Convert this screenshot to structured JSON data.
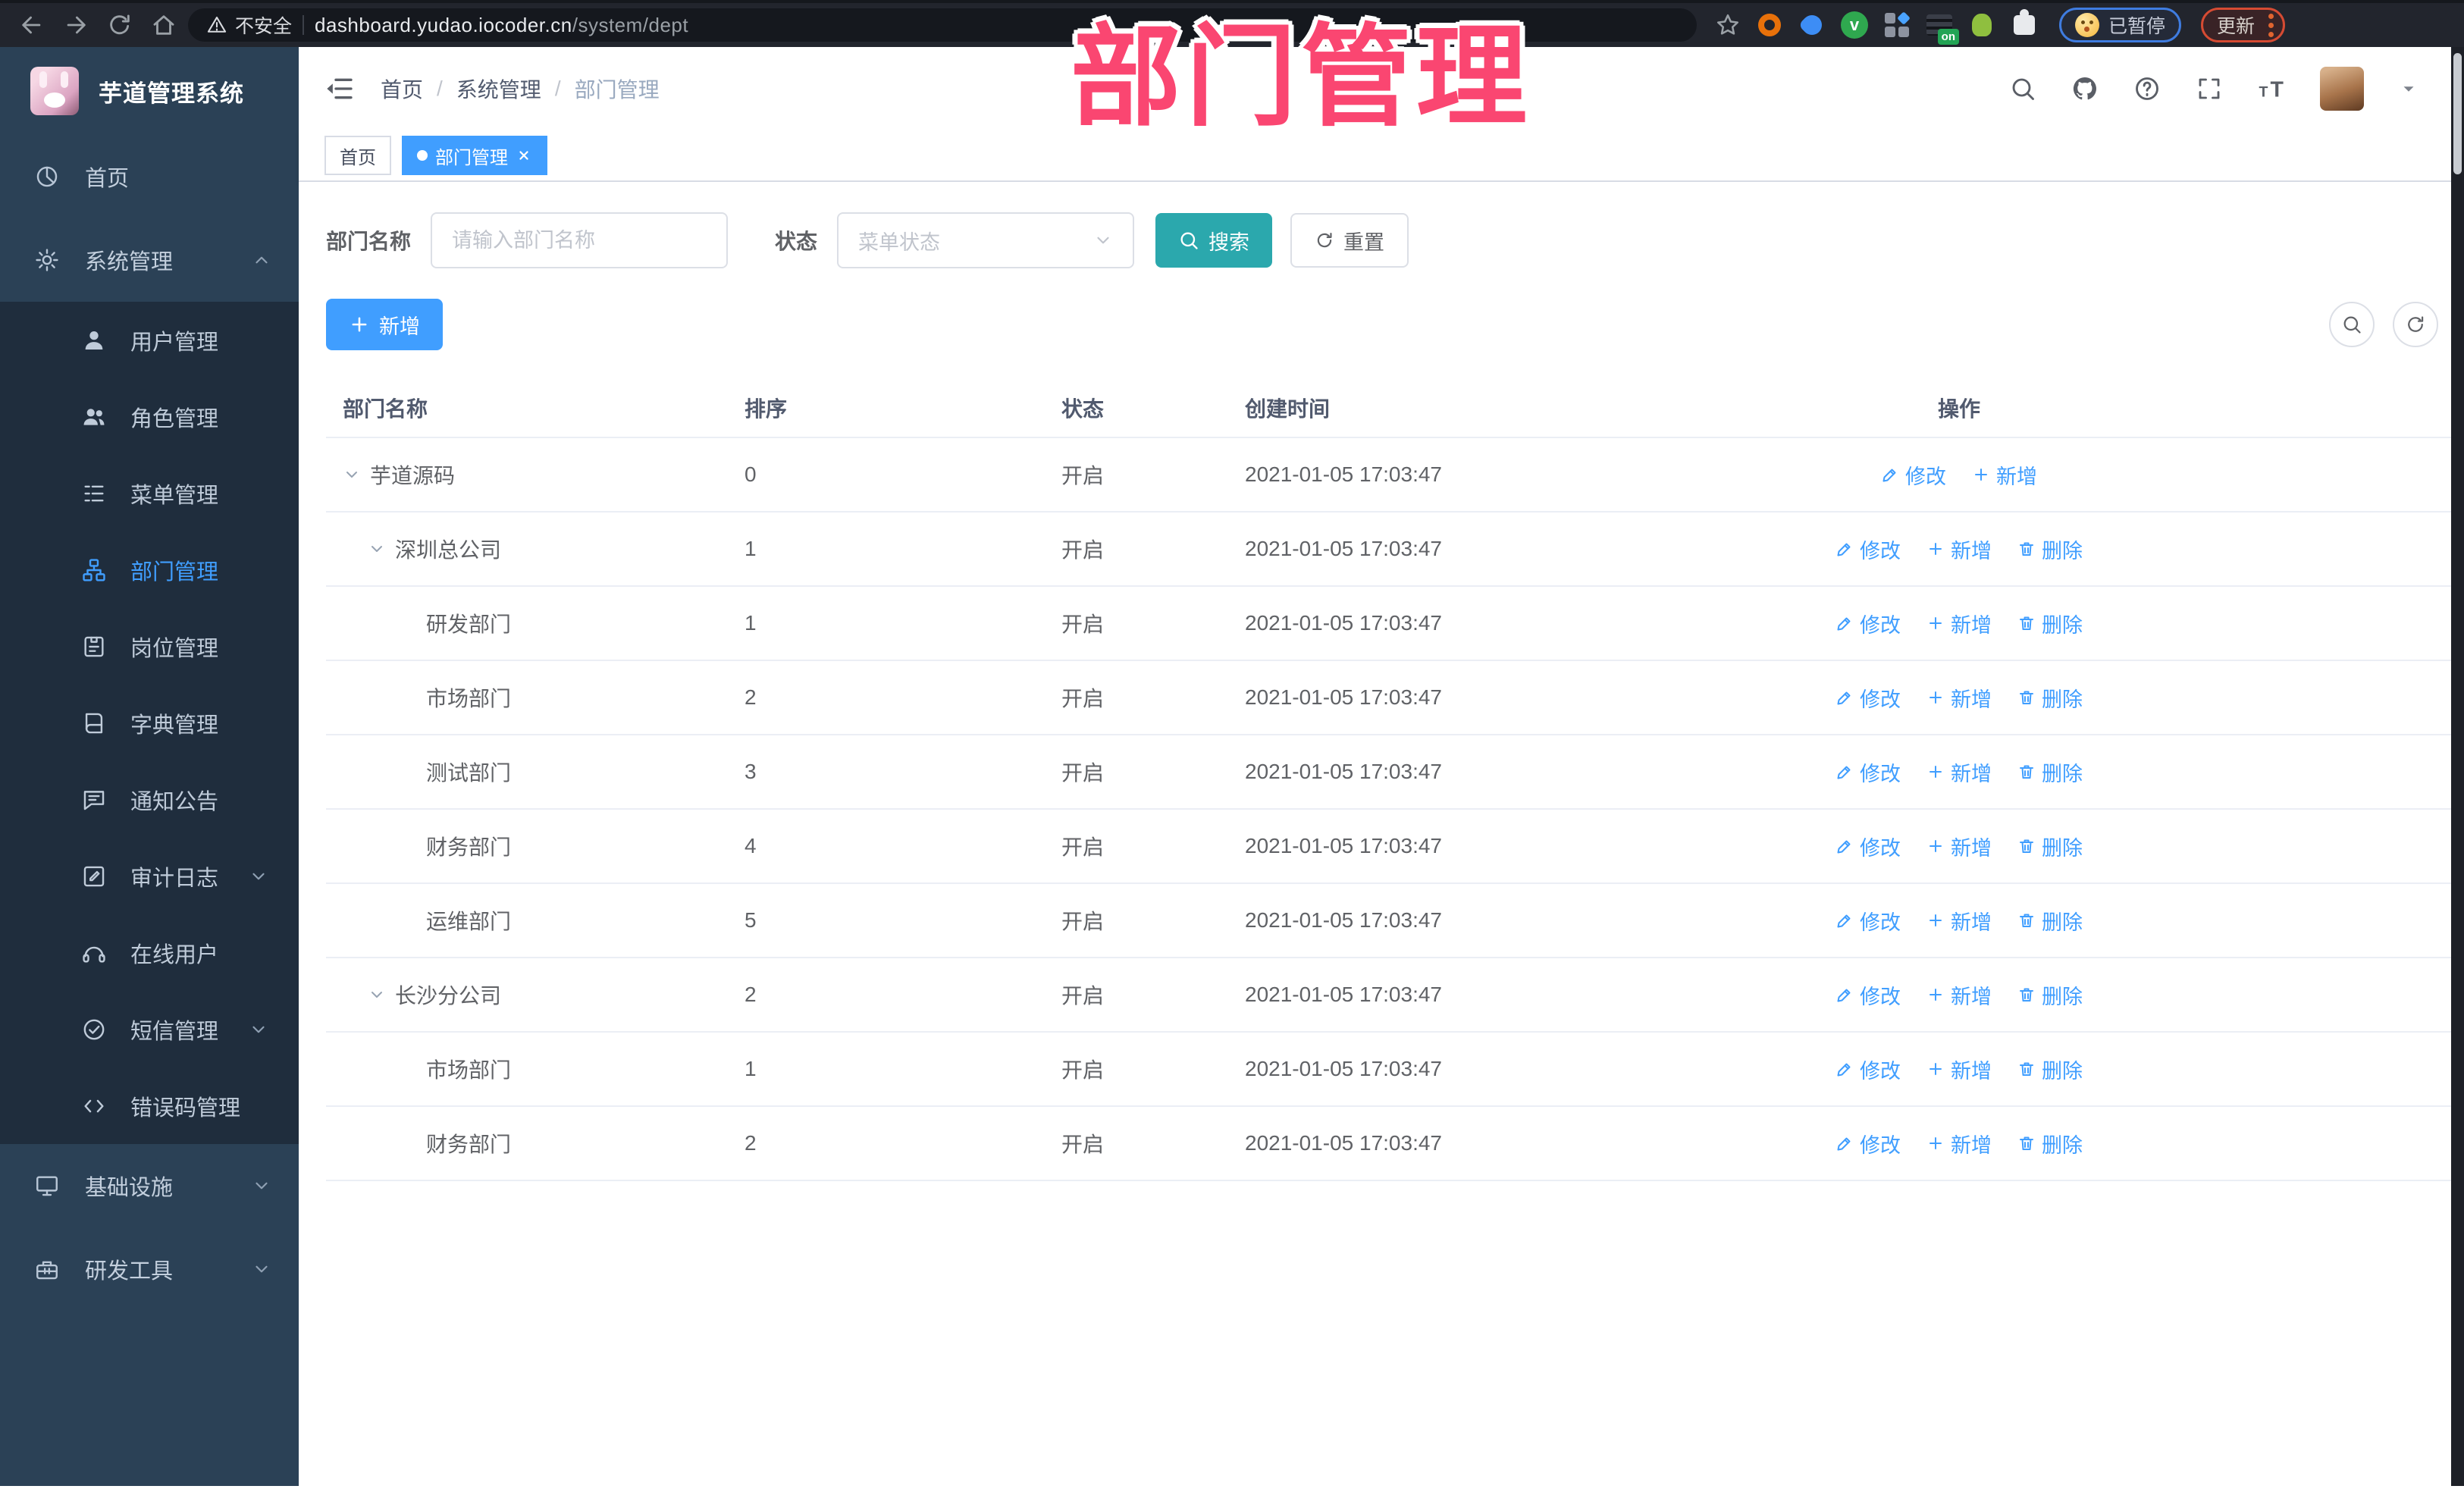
{
  "theme": {
    "accent": "#409EFF",
    "search_button": "#2BA8AD",
    "overlay_pink": "#FA4671",
    "sidebar_bg": "#2B4156",
    "submenu_bg": "#1F2D3D"
  },
  "browser": {
    "nav_icons": [
      "back-icon",
      "forward-icon",
      "reload-icon",
      "home-icon"
    ],
    "security_text": "不安全",
    "url_host": "dashboard.yudao.iocoder.cn",
    "url_path": "/system/dept",
    "extensions": [
      {
        "icon": "bookmark-star-icon"
      },
      {
        "icon": "adblock-ring-icon"
      },
      {
        "icon": "blue-drop-icon"
      },
      {
        "icon": "green-check-icon",
        "glyph": "v"
      },
      {
        "icon": "tab-grid-icon"
      },
      {
        "icon": "onetab-icon",
        "badge": "on"
      },
      {
        "icon": "android-figure-icon"
      },
      {
        "icon": "puzzle-icon"
      }
    ],
    "paused_pill": {
      "icon": "dizzy-face-icon",
      "label": "已暂停"
    },
    "update_pill": {
      "label": "更新",
      "menu_icon": "kebab-icon"
    }
  },
  "sidebar": {
    "app_title": "芋道管理系统",
    "logo_icon": "bunny-logo",
    "top_menu": [
      {
        "icon": "dashboard-icon",
        "label": "首页"
      },
      {
        "icon": "gear-icon",
        "label": "系统管理",
        "chevron": "up"
      }
    ],
    "submenu": [
      {
        "icon": "user-icon",
        "label": "用户管理"
      },
      {
        "icon": "users-icon",
        "label": "角色管理"
      },
      {
        "icon": "menu-list-icon",
        "label": "菜单管理"
      },
      {
        "icon": "org-tree-icon",
        "label": "部门管理",
        "active": true
      },
      {
        "icon": "badge-icon",
        "label": "岗位管理"
      },
      {
        "icon": "book-icon",
        "label": "字典管理"
      },
      {
        "icon": "chat-bubble-icon",
        "label": "通知公告"
      },
      {
        "icon": "log-edit-icon",
        "label": "审计日志",
        "chevron": "down"
      },
      {
        "icon": "headset-icon",
        "label": "在线用户"
      },
      {
        "icon": "check-circle-icon",
        "label": "短信管理",
        "chevron": "down"
      },
      {
        "icon": "code-icon",
        "label": "错误码管理"
      }
    ],
    "bottom_menu": [
      {
        "icon": "monitor-icon",
        "label": "基础设施",
        "chevron": "down"
      },
      {
        "icon": "toolbox-icon",
        "label": "研发工具",
        "chevron": "down"
      }
    ]
  },
  "header": {
    "breadcrumb": [
      "首页",
      "系统管理",
      "部门管理"
    ],
    "right_icons": [
      "search-icon",
      "github-icon",
      "question-icon",
      "fullscreen-icon",
      "font-size-icon"
    ]
  },
  "tags": [
    {
      "label": "首页",
      "active": false
    },
    {
      "label": "部门管理",
      "active": true,
      "closable": true
    }
  ],
  "overlay_title": "部门管理",
  "filters": {
    "name_label": "部门名称",
    "name_placeholder": "请输入部门名称",
    "status_label": "状态",
    "status_placeholder": "菜单状态",
    "search_label": "搜索",
    "reset_label": "重置"
  },
  "toolbar": {
    "add_label": "新增"
  },
  "table": {
    "headers": [
      "部门名称",
      "排序",
      "状态",
      "创建时间",
      "操作"
    ],
    "rows": [
      {
        "name": "芋道源码",
        "level": 0,
        "expandable": true,
        "sort": "0",
        "status": "开启",
        "created": "2021-01-05 17:03:47",
        "actions": [
          {
            "icon": "edit-icon",
            "label": "修改"
          },
          {
            "icon": "plus-icon",
            "label": "新增"
          }
        ]
      },
      {
        "name": "深圳总公司",
        "level": 1,
        "expandable": true,
        "sort": "1",
        "status": "开启",
        "created": "2021-01-05 17:03:47",
        "actions": [
          {
            "icon": "edit-icon",
            "label": "修改"
          },
          {
            "icon": "plus-icon",
            "label": "新增"
          },
          {
            "icon": "trash-icon",
            "label": "删除"
          }
        ]
      },
      {
        "name": "研发部门",
        "level": 2,
        "expandable": false,
        "sort": "1",
        "status": "开启",
        "created": "2021-01-05 17:03:47",
        "actions": [
          {
            "icon": "edit-icon",
            "label": "修改"
          },
          {
            "icon": "plus-icon",
            "label": "新增"
          },
          {
            "icon": "trash-icon",
            "label": "删除"
          }
        ]
      },
      {
        "name": "市场部门",
        "level": 2,
        "expandable": false,
        "sort": "2",
        "status": "开启",
        "created": "2021-01-05 17:03:47",
        "actions": [
          {
            "icon": "edit-icon",
            "label": "修改"
          },
          {
            "icon": "plus-icon",
            "label": "新增"
          },
          {
            "icon": "trash-icon",
            "label": "删除"
          }
        ]
      },
      {
        "name": "测试部门",
        "level": 2,
        "expandable": false,
        "sort": "3",
        "status": "开启",
        "created": "2021-01-05 17:03:47",
        "actions": [
          {
            "icon": "edit-icon",
            "label": "修改"
          },
          {
            "icon": "plus-icon",
            "label": "新增"
          },
          {
            "icon": "trash-icon",
            "label": "删除"
          }
        ]
      },
      {
        "name": "财务部门",
        "level": 2,
        "expandable": false,
        "sort": "4",
        "status": "开启",
        "created": "2021-01-05 17:03:47",
        "actions": [
          {
            "icon": "edit-icon",
            "label": "修改"
          },
          {
            "icon": "plus-icon",
            "label": "新增"
          },
          {
            "icon": "trash-icon",
            "label": "删除"
          }
        ]
      },
      {
        "name": "运维部门",
        "level": 2,
        "expandable": false,
        "sort": "5",
        "status": "开启",
        "created": "2021-01-05 17:03:47",
        "actions": [
          {
            "icon": "edit-icon",
            "label": "修改"
          },
          {
            "icon": "plus-icon",
            "label": "新增"
          },
          {
            "icon": "trash-icon",
            "label": "删除"
          }
        ]
      },
      {
        "name": "长沙分公司",
        "level": 1,
        "expandable": true,
        "sort": "2",
        "status": "开启",
        "created": "2021-01-05 17:03:47",
        "actions": [
          {
            "icon": "edit-icon",
            "label": "修改"
          },
          {
            "icon": "plus-icon",
            "label": "新增"
          },
          {
            "icon": "trash-icon",
            "label": "删除"
          }
        ]
      },
      {
        "name": "市场部门",
        "level": 2,
        "expandable": false,
        "sort": "1",
        "status": "开启",
        "created": "2021-01-05 17:03:47",
        "actions": [
          {
            "icon": "edit-icon",
            "label": "修改"
          },
          {
            "icon": "plus-icon",
            "label": "新增"
          },
          {
            "icon": "trash-icon",
            "label": "删除"
          }
        ]
      },
      {
        "name": "财务部门",
        "level": 2,
        "expandable": false,
        "sort": "2",
        "status": "开启",
        "created": "2021-01-05 17:03:47",
        "actions": [
          {
            "icon": "edit-icon",
            "label": "修改"
          },
          {
            "icon": "plus-icon",
            "label": "新增"
          },
          {
            "icon": "trash-icon",
            "label": "删除"
          }
        ]
      }
    ]
  }
}
